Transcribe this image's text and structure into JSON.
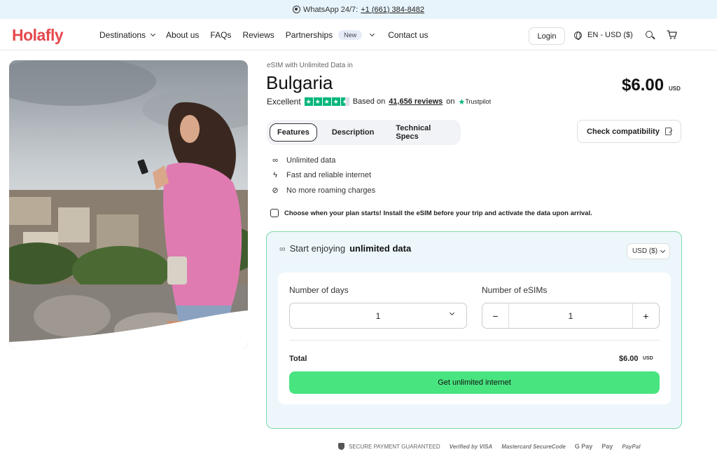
{
  "topbar": {
    "whatsapp_label": "WhatsApp 24/7:",
    "phone": "+1 (661) 384-8482"
  },
  "header": {
    "logo": "Holafly",
    "nav": [
      "Destinations",
      "About us",
      "FAQs",
      "Reviews",
      "Partnerships",
      "Contact us"
    ],
    "new_badge": "New",
    "login": "Login",
    "lang": "EN - USD ($)"
  },
  "product": {
    "eyebrow": "eSIM with Unlimited Data in",
    "country": "Bulgaria",
    "price": "$6.00",
    "currency": "USD",
    "rating_word": "Excellent",
    "based_on": "Based on",
    "reviews": "41,656 reviews",
    "on": "on",
    "trustpilot": "Trustpilot",
    "tabs": [
      "Features",
      "Description",
      "Technical Specs"
    ],
    "check_compat": "Check compatibility",
    "features": [
      "Unlimited data",
      "Fast and reliable internet",
      "No more roaming charges"
    ],
    "note": "Choose when your plan starts! Install the eSIM before your trip and activate the data upon arrival."
  },
  "plan": {
    "head_prefix": "Start enjoying",
    "head_bold": "unlimited data",
    "currency_select": "USD ($)",
    "days_label": "Number of days",
    "days_value": "1",
    "esims_label": "Number of eSIMs",
    "esims_value": "1",
    "total_label": "Total",
    "total_value": "$6.00",
    "total_currency": "USD",
    "cta": "Get unlimited internet"
  },
  "payments": {
    "secure": "SECURE PAYMENT GUARANTEED",
    "methods": [
      "Verified by VISA",
      "Mastercard SecureCode",
      "G Pay",
      "Pay",
      "PayPal"
    ]
  },
  "colors": {
    "brand": "#e5484d",
    "cta": "#48e47f",
    "trustpilot": "#00b67a",
    "plan_border": "#7fd9a8"
  }
}
